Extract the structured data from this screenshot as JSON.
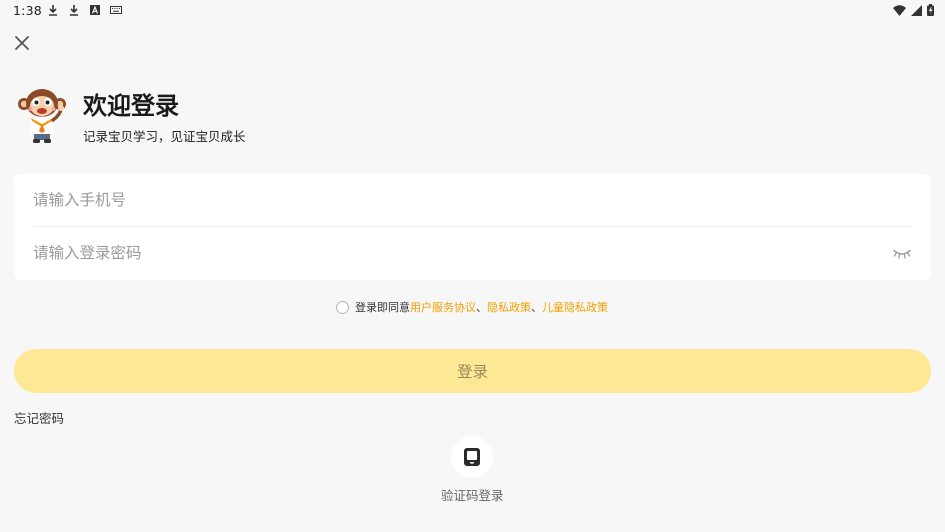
{
  "status_bar": {
    "time": "1:38",
    "left_icons": [
      "download-icon",
      "download-icon",
      "font-a-icon",
      "keyboard-icon"
    ],
    "right_icons": [
      "wifi-icon",
      "signal-icon",
      "battery-icon"
    ]
  },
  "header": {
    "close_icon": "close-icon",
    "mascot_icon": "monkey-mascot-icon",
    "title": "欢迎登录",
    "subtitle": "记录宝贝学习，见证宝贝成长"
  },
  "form": {
    "phone_placeholder": "请输入手机号",
    "phone_value": "",
    "password_placeholder": "请输入登录密码",
    "password_value": "",
    "eye_icon": "eye-closed-icon"
  },
  "agreement": {
    "checked": false,
    "prefix": "登录即同意",
    "user_agreement": "用户服务协议",
    "separator1": "、",
    "privacy_policy": "隐私政策",
    "separator2": "、",
    "child_privacy_policy": "儿童隐私政策"
  },
  "actions": {
    "login_label": "登录",
    "forgot_password": "忘记密码",
    "sms_login_icon": "tablet-icon",
    "sms_login_label": "验证码登录"
  },
  "colors": {
    "background": "#f7f7f7",
    "accent_link": "#f0a000",
    "login_button_disabled": "#fde896",
    "login_text_disabled": "#9a8a55"
  }
}
